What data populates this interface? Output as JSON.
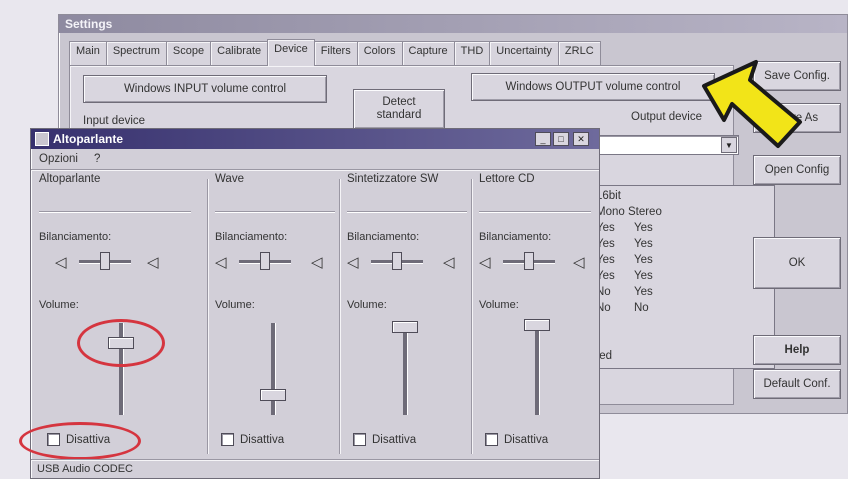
{
  "settings": {
    "title": "Settings",
    "tabs": [
      "Main",
      "Spectrum",
      "Scope",
      "Calibrate",
      "Device",
      "Filters",
      "Colors",
      "Capture",
      "THD",
      "Uncertainty",
      "ZRLC"
    ],
    "active_tab": "Device",
    "input_volume_button": "Windows INPUT volume control",
    "output_volume_button": "Windows OUTPUT volume control",
    "detect_standard_button": "Detect standard",
    "input_device_label": "Input device",
    "output_device_label": "Output device",
    "right_buttons": {
      "save_config": "Save Config.",
      "save_as": "Save As",
      "open_config": "Open Config",
      "ok": "OK",
      "help": "Help",
      "default_conf": "Default Conf."
    },
    "capability_table": {
      "header1": "16bit",
      "header2": "Mono Stereo",
      "rows": [
        [
          "Yes",
          "Yes"
        ],
        [
          "Yes",
          "Yes"
        ],
        [
          "Yes",
          "Yes"
        ],
        [
          "Yes",
          "Yes"
        ],
        [
          "No",
          "Yes"
        ],
        [
          "No",
          "No"
        ]
      ],
      "footer": "ted"
    }
  },
  "mixer": {
    "title": "Altoparlante",
    "menu": [
      "Opzioni",
      "?"
    ],
    "channels": [
      {
        "title": "Altoparlante",
        "balance_label": "Bilanciamento:",
        "volume_label": "Volume:",
        "mute_label": "Disattiva",
        "muted": false
      },
      {
        "title": "Wave",
        "balance_label": "Bilanciamento:",
        "volume_label": "Volume:",
        "mute_label": "Disattiva",
        "muted": false
      },
      {
        "title": "Sintetizzatore SW",
        "balance_label": "Bilanciamento:",
        "volume_label": "Volume:",
        "mute_label": "Disattiva",
        "muted": false
      },
      {
        "title": "Lettore CD",
        "balance_label": "Bilanciamento:",
        "volume_label": "Volume:",
        "mute_label": "Disattiva",
        "muted": false
      }
    ],
    "status": "USB Audio CODEC"
  },
  "colors": {
    "highlight": "#d5353f",
    "arrow": "#f2e418",
    "titlebar": "#37316e"
  }
}
